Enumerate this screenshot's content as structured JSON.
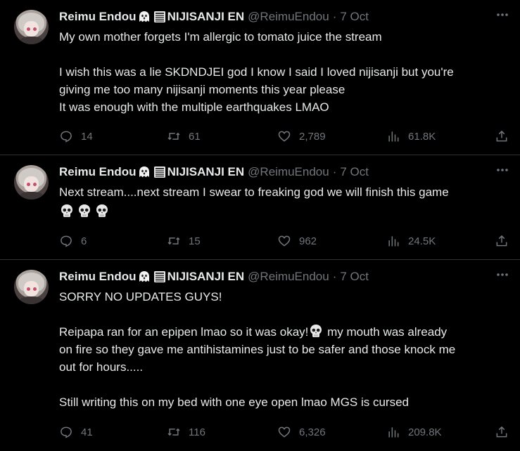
{
  "tweets": [
    {
      "author": "Reimu Endou",
      "affiliation": "NIJISANJI EN",
      "handle": "@ReimuEndou",
      "separator": "·",
      "date": "7 Oct",
      "text": "My own mother forgets I'm allergic to tomato juice the stream\n\nI wish this was a lie SKDNDJEI god I know I said I loved nijisanji but you're\ngiving me too many nijisanji moments this year please\nIt was enough with the multiple earthquakes LMAO",
      "replies": "14",
      "retweets": "61",
      "likes": "2,789",
      "views": "61.8K"
    },
    {
      "author": "Reimu Endou",
      "affiliation": "NIJISANJI EN",
      "handle": "@ReimuEndou",
      "separator": "·",
      "date": "7 Oct",
      "text": "Next stream....next stream I swear to freaking god we will finish this game",
      "replies": "6",
      "retweets": "15",
      "likes": "962",
      "views": "24.5K"
    },
    {
      "author": "Reimu Endou",
      "affiliation": "NIJISANJI EN",
      "handle": "@ReimuEndou",
      "separator": "·",
      "date": "7 Oct",
      "text_part1": "SORRY NO UPDATES GUYS!\n\nReipapa ran for an epipen lmao so it was okay!",
      "text_part2": " my mouth was already\non fire so they gave me antihistamines just to be safer and those knock me\nout for hours.....\n\nStill writing this on my bed with one eye open lmao MGS is cursed",
      "replies": "41",
      "retweets": "116",
      "likes": "6,326",
      "views": "209.8K"
    }
  ],
  "icons": {
    "reply": "reply-icon",
    "retweet": "retweet-icon",
    "like": "heart-icon",
    "views": "views-icon",
    "share": "share-icon",
    "more": "more-icon"
  },
  "colors": {
    "background": "#000000",
    "text": "#e7e9ea",
    "muted": "#71767b",
    "divider": "#2f3336"
  }
}
